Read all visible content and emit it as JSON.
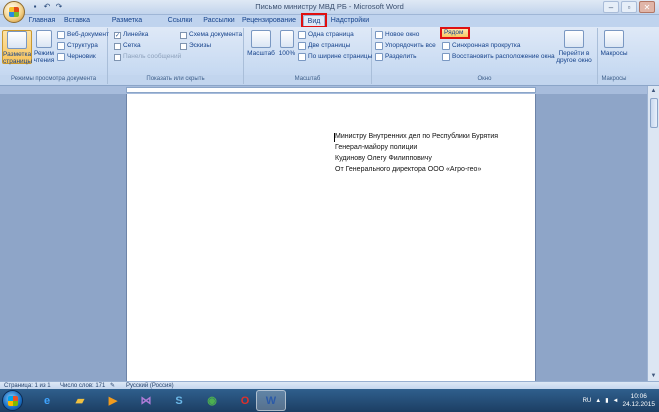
{
  "window": {
    "title": "Письмо министру МВД РБ - Microsoft Word"
  },
  "tabs": [
    "Главная",
    "Вставка",
    "Разметка страницы",
    "Ссылки",
    "Рассылки",
    "Рецензирование",
    "Вид",
    "Надстройки"
  ],
  "active_tab": "Вид",
  "ribbon": {
    "views": {
      "page_layout": "Разметка страницы",
      "reading": "Режим чтения",
      "web": "Веб-документ",
      "outline": "Структура",
      "draft": "Черновик",
      "label": "Режимы просмотра документа"
    },
    "show": {
      "ruler": "Линейка",
      "grid": "Сетка",
      "message_bar": "Панель сообщений",
      "doc_map": "Схема документа",
      "thumbnails": "Эскизы",
      "label": "Показать или скрыть"
    },
    "zoom": {
      "zoom": "Масштаб",
      "hundred": "100%",
      "one_page": "Одна страница",
      "two_pages": "Две страницы",
      "page_width": "По ширине страницы",
      "label": "Масштаб"
    },
    "window": {
      "new_window": "Новое окно",
      "arrange_all": "Упорядочить все",
      "split": "Разделить",
      "side_by_side": "Рядом",
      "sync_scroll": "Синхронная прокрутка",
      "reset_position": "Восстановить расположение окна",
      "switch": "Перейти в другое окно",
      "label": "Окно"
    },
    "macros": {
      "macros": "Макросы",
      "label": "Макросы"
    }
  },
  "document": {
    "lines": [
      "Министру Внутренних дел по Республики Бурятия",
      "Генерал-майору полиции",
      "Кудинову Олегу  Филипповичу",
      "От  Генерального директора  ООО  «Агро-гео»"
    ]
  },
  "statusbar": {
    "page": "Страница: 1 из 1",
    "words": "Число слов: 171",
    "language": "Русский (Россия)"
  },
  "tray": {
    "lang": "RU",
    "time": "10:06",
    "date": "24.12.2015"
  },
  "colors": {
    "highlight_box": "#e01010",
    "ribbon_bg": "#dfe9f7",
    "doc_bg": "#8ea5c8"
  }
}
